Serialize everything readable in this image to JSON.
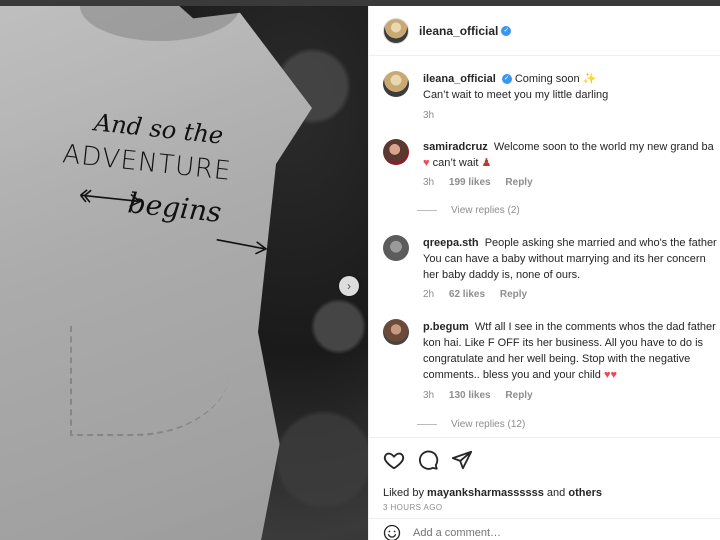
{
  "post_author": {
    "username": "ileana_official",
    "verified": true
  },
  "caption": {
    "username": "ileana_official",
    "text_line1": "Coming soon ✨",
    "text_line2": "Can’t wait to meet you my little darling",
    "time": "3h"
  },
  "photo": {
    "print_line1": "And so the",
    "print_line2": "ADVENTURE",
    "print_line3": "begins",
    "next_icon": "chevron-right-icon"
  },
  "comments": [
    {
      "username": "samiradcruz",
      "text_line1": "Welcome soon to the world my new grand ba",
      "text_line2": "can’t wait",
      "time": "3h",
      "likes": "199 likes",
      "reply": "Reply",
      "view_replies": "View replies (2)"
    },
    {
      "username": "qreepa.sth",
      "text_line1": "People asking she married and who's the father",
      "text_line2": "You can have a baby without marrying and its her concern",
      "text_line3": "her baby daddy is, none of ours.",
      "time": "2h",
      "likes": "62 likes",
      "reply": "Reply"
    },
    {
      "username": "p.begum",
      "text_line1": "Wtf all I see in the comments whos the dad father",
      "text_line2": "kon hai. Like F OFF its her business. All you have to do is",
      "text_line3": "congratulate and her well being. Stop with the negative",
      "text_line4": "comments.. bless you and your child",
      "time": "3h",
      "likes": "130 likes",
      "reply": "Reply",
      "view_replies": "View replies (12)"
    }
  ],
  "actions": {
    "like_icon": "heart-outline-icon",
    "comment_icon": "comment-icon",
    "share_icon": "share-icon",
    "liked_by_prefix": "Liked by",
    "liked_by_user": "mayanksharmassssss",
    "liked_by_and": "and",
    "liked_by_others": "others",
    "time_ago": "3 HOURS AGO"
  },
  "add_comment": {
    "placeholder": "Add a comment…",
    "emoji_icon": "smiley-icon"
  },
  "colors": {
    "verified": "#3897f0",
    "heart": "#ed4956",
    "muted": "#8e8e8e"
  }
}
